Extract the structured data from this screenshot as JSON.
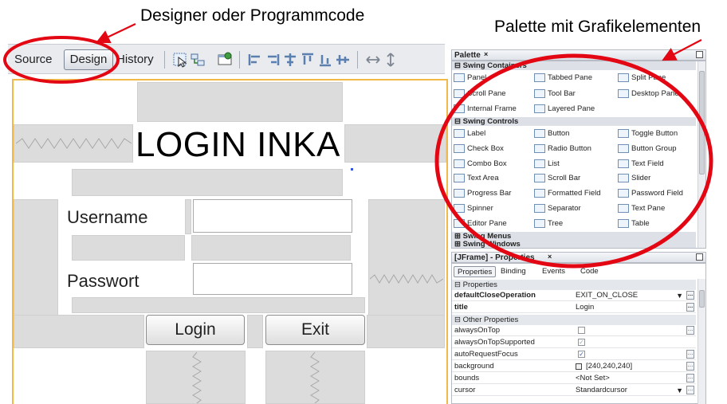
{
  "annotations": {
    "designer": "Designer oder Programmcode",
    "palette": "Palette mit Grafikelementen"
  },
  "toolbar": {
    "source": "Source",
    "design": "Design",
    "history": "History"
  },
  "form": {
    "title": "LOGIN INKA",
    "username_label": "Username",
    "password_label": "Passwort",
    "login_button": "Login",
    "exit_button": "Exit"
  },
  "palette": {
    "title": "Palette",
    "close_symbol": "×",
    "categories": {
      "containers": "Swing Containers",
      "controls": "Swing Controls",
      "menus": "Swing Menus",
      "windows": "Swing Windows"
    },
    "containers": [
      "Panel",
      "Tabbed Pane",
      "Split Pane",
      "Scroll Pane",
      "Tool Bar",
      "Desktop Pane",
      "Internal Frame",
      "Layered Pane"
    ],
    "controls": [
      "Label",
      "Button",
      "Toggle Button",
      "Check Box",
      "Radio Button",
      "Button Group",
      "Combo Box",
      "List",
      "Text Field",
      "Text Area",
      "Scroll Bar",
      "Slider",
      "Progress Bar",
      "Formatted Field",
      "Password Field",
      "Spinner",
      "Separator",
      "Text Pane",
      "Editor Pane",
      "Tree",
      "Table"
    ]
  },
  "properties": {
    "title": "[JFrame] - Properties",
    "tabs": [
      "Properties",
      "Binding",
      "Events",
      "Code"
    ],
    "section_properties": "Properties",
    "section_other": "Other Properties",
    "rows": {
      "defaultCloseOperation": {
        "key": "defaultCloseOperation",
        "value": "EXIT_ON_CLOSE"
      },
      "title": {
        "key": "title",
        "value": "Login"
      },
      "alwaysOnTop": {
        "key": "alwaysOnTop"
      },
      "alwaysOnTopSupported": {
        "key": "alwaysOnTopSupported"
      },
      "autoRequestFocus": {
        "key": "autoRequestFocus"
      },
      "background": {
        "key": "background",
        "value": "[240,240,240]"
      },
      "bounds": {
        "key": "bounds",
        "value": "<Not Set>"
      },
      "cursor": {
        "key": "cursor",
        "value": "Standardcursor"
      }
    },
    "checkbox_states": {
      "alwaysOnTop": false,
      "alwaysOnTopSupported": true,
      "autoRequestFocus": true
    }
  },
  "colors": {
    "highlight": "#e30613",
    "frame_border": "#f0b94a"
  }
}
